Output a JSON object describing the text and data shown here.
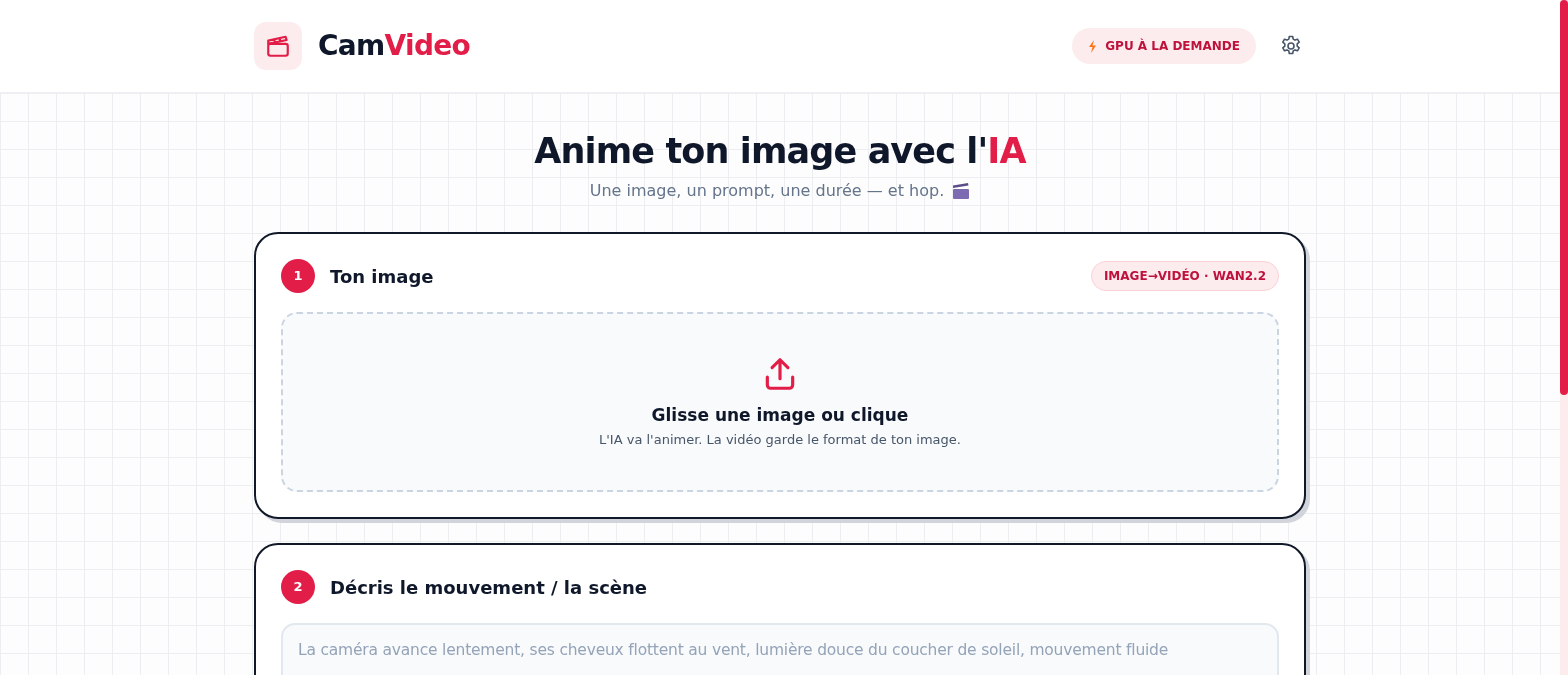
{
  "brand": {
    "part_1": "Cam",
    "part_2": "Video"
  },
  "header": {
    "gpu_badge": "GPU À LA DEMANDE"
  },
  "hero": {
    "title": "Anime ton image avec l'",
    "title_accent": "IA",
    "subtitle": "Une image, un prompt, une durée — et hop."
  },
  "steps": [
    {
      "kind": "upload",
      "number": "1",
      "title": "Ton image",
      "tag": "IMAGE→VIDÉO · WAN2.2",
      "drop_title": "Glisse une image ou clique",
      "drop_hint": "L'IA va l'animer. La vidéo garde le format de ton image."
    },
    {
      "kind": "prompt",
      "number": "2",
      "title": "Décris le mouvement / la scène",
      "placeholder": "La caméra avance lentement, ses cheveux flottent au vent, lumière douce du coucher de soleil, mouvement fluide"
    }
  ]
}
